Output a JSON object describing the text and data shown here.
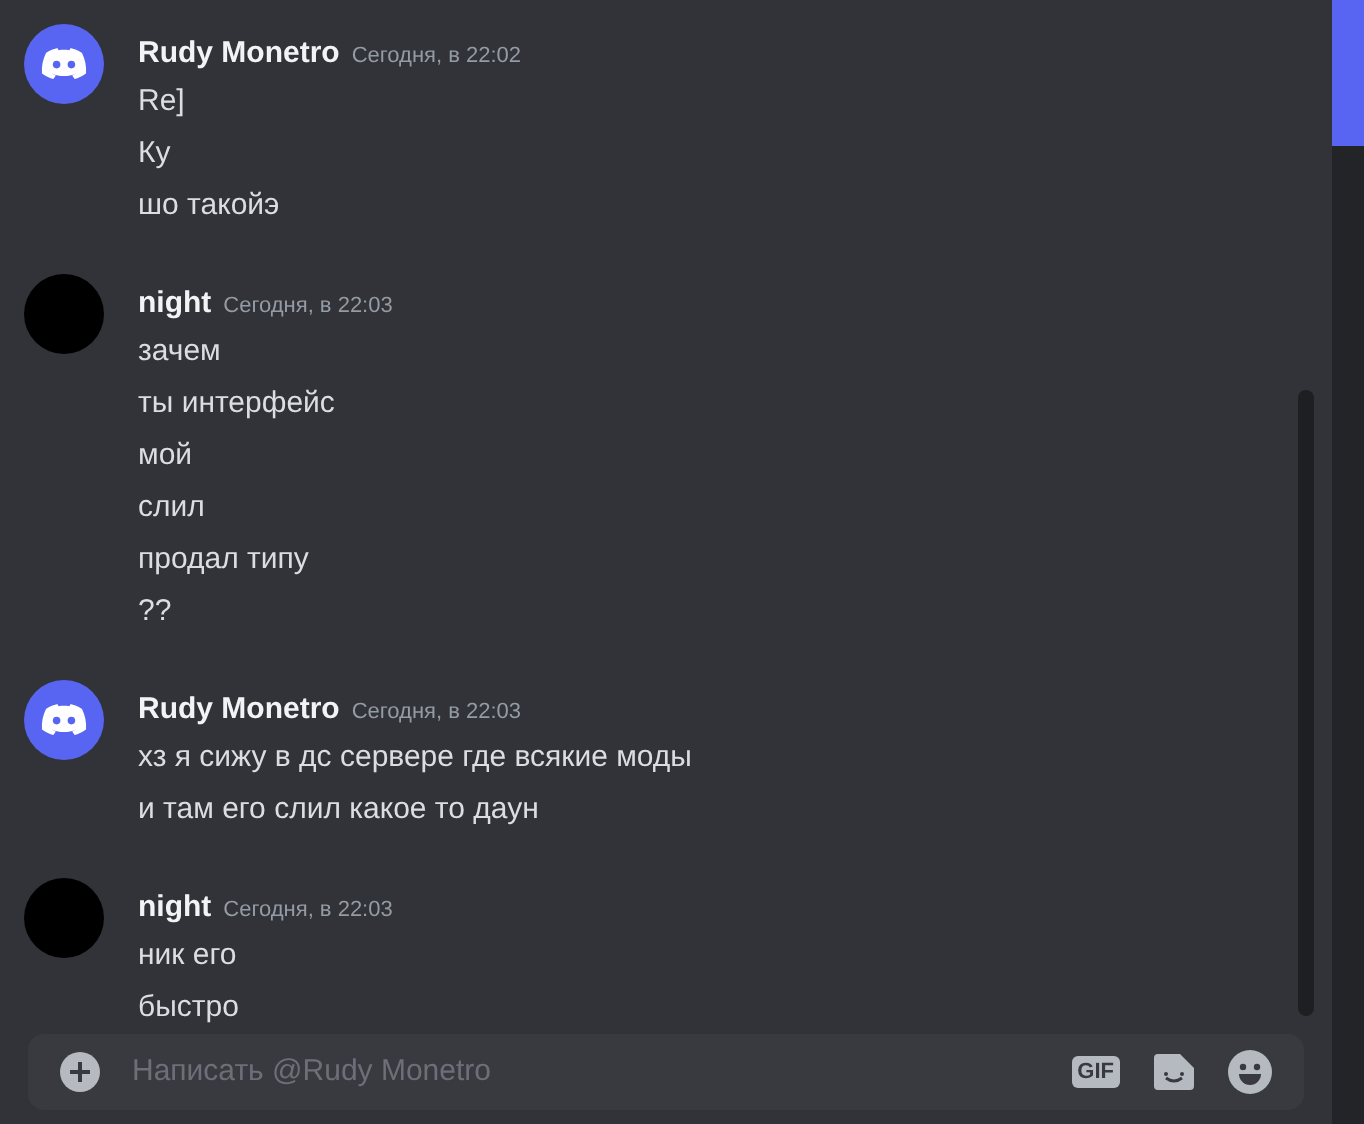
{
  "messages": [
    {
      "author": "Rudy Monetro",
      "avatar": {
        "kind": "discord"
      },
      "time": "Сегодня, в 22:02",
      "lines": [
        "Re]",
        "Ку",
        "шо такойэ"
      ]
    },
    {
      "author": "night",
      "avatar": {
        "kind": "black"
      },
      "time": "Сегодня, в 22:03",
      "lines": [
        "зачем",
        "ты интерфейс",
        "мой",
        "слил",
        "продал типу",
        "??"
      ]
    },
    {
      "author": "Rudy Monetro",
      "avatar": {
        "kind": "discord"
      },
      "time": "Сегодня, в 22:03",
      "lines": [
        "хз я сижу в дс сервере где всякие моды",
        "и там его слил какое то даун"
      ]
    },
    {
      "author": "night",
      "avatar": {
        "kind": "black"
      },
      "time": "Сегодня, в 22:03",
      "lines": [
        "ник его",
        "быстро"
      ]
    }
  ],
  "composer": {
    "placeholder": "Написать @Rudy Monetro",
    "gif_label": "GIF"
  }
}
